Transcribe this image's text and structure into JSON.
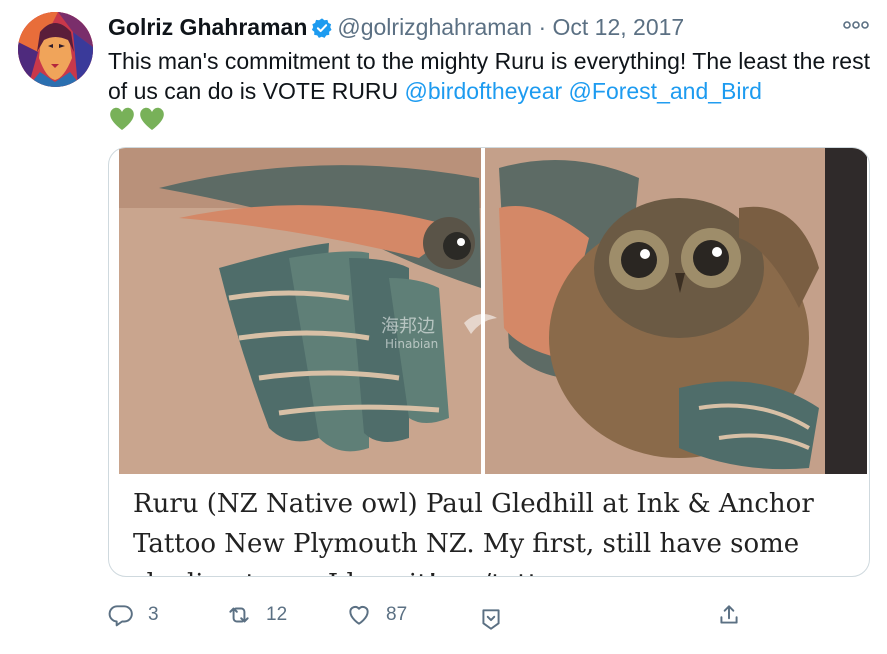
{
  "tweet": {
    "author_name": "Golriz Ghahraman",
    "handle": "@golrizghahraman",
    "separator": "·",
    "date": "Oct 12, 2017",
    "text_main": "This man's commitment to the mighty Ruru is everything! The least the rest of us can do is VOTE RURU ",
    "mention_1": "@birdoftheyear",
    "mention_2": "@Forest_and_Bird",
    "emojis": "green-heart x2",
    "verified": true
  },
  "card": {
    "caption": "Ruru (NZ Native owl) Paul Gledhill at Ink & Anchor Tattoo New Plymouth NZ. My first, still have some shading to go. I love it! • r/tattoos",
    "watermark_cn": "海邦边",
    "watermark_en": "Hinabian"
  },
  "actions": {
    "reply_count": "3",
    "retweet_count": "12",
    "like_count": "87"
  },
  "icons": {
    "more": "more-icon",
    "reply": "reply-icon",
    "retweet": "retweet-icon",
    "like": "heart-icon",
    "save": "bookmark-icon",
    "share": "share-icon"
  },
  "colors": {
    "link": "#1d9bf0",
    "muted": "#5b7083",
    "verified": "#1d9bf0",
    "heart_emoji": "#78b159"
  }
}
